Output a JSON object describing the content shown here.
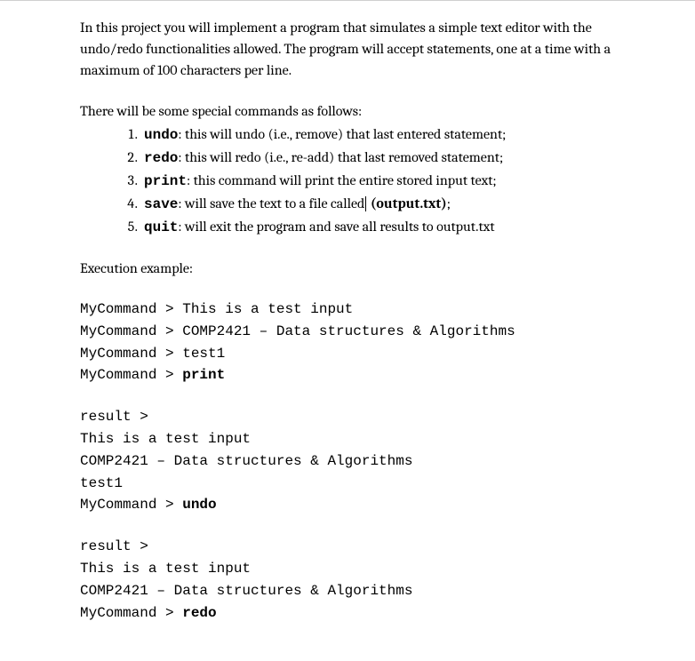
{
  "intro": "In this project you will implement a program that simulates a simple text editor with the undo/redo functionalities allowed. The program will accept statements, one at a time with a maximum of 100 characters per line.",
  "commands_intro": "There will be some special commands as follows:",
  "commands": [
    {
      "name": "undo",
      "desc": ": this will undo (i.e., remove) that last entered statement;"
    },
    {
      "name": "redo",
      "desc": ": this will redo (i.e., re-add) that last removed statement;"
    },
    {
      "name": "print",
      "desc": ": this command will print the entire stored input text;"
    },
    {
      "name": "save",
      "desc_pre": ": will save the text to a file called",
      "filename": " (output.txt)",
      "desc_post": ";"
    },
    {
      "name": "quit",
      "desc": ": will exit the program and save all results to output.txt"
    }
  ],
  "exec_header": "Execution example:",
  "exec": {
    "prompt": "MyCommand > ",
    "result_prompt": "result >",
    "block1": {
      "line1": "This is a test input",
      "line2": "COMP2421 – Data structures & Algorithms",
      "line3": "test1",
      "cmd": "print"
    },
    "block2": {
      "line1": "This is a test input",
      "line2": "COMP2421 – Data structures & Algorithms",
      "line3": "test1",
      "cmd": "undo"
    },
    "block3": {
      "line1": "This is a test input",
      "line2": "COMP2421 – Data structures & Algorithms",
      "cmd": "redo"
    }
  }
}
